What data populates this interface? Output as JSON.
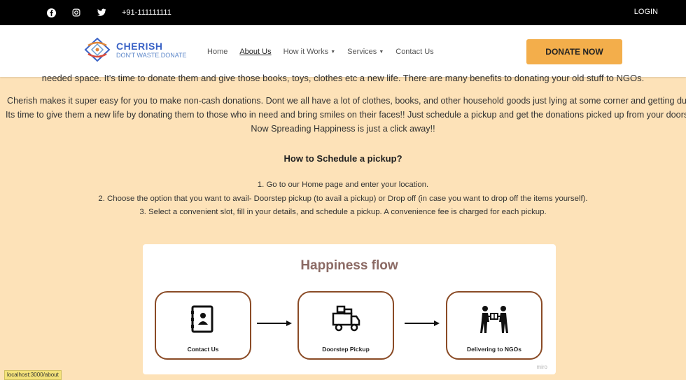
{
  "topbar": {
    "phone": "+91-111111111",
    "login": "LOGIN",
    "icons": [
      "facebook-icon",
      "instagram-icon",
      "twitter-icon"
    ]
  },
  "brand": {
    "title": "CHERISH",
    "tagline": "DON'T WASTE.DONATE"
  },
  "nav": {
    "home": "Home",
    "about": "About Us",
    "how_it_works": "How it Works",
    "services": "Services",
    "contact": "Contact Us"
  },
  "donate_button": "DONATE NOW",
  "content": {
    "clipped_line": "needed space. It's time to donate them and give those books, toys, clothes etc a new life. There are many benefits to donating your old stuff to NGOs.",
    "para_line1": "Cherish makes it super easy for you to make non-cash donations. Dont we all have a lot of clothes, books, and other household goods just lying at some corner and getting dusted",
    "para_line2": "Its time to give them a new life by donating them to those who in need and bring smiles on their faces!! Just schedule a pickup and get the donations picked up from your doorstep",
    "para_line3": "Now Spreading Happiness is just a click away!!",
    "howto_title": "How to Schedule a pickup?",
    "steps": [
      "1. Go to our Home page and enter your location.",
      "2. Choose the option that you want to avail- Doorstep pickup (to avail a pickup) or Drop off (in case you want to drop off the items yourself).",
      "3. Select a convenient slot, fill in your details, and schedule a pickup. A convenience fee is charged for each pickup."
    ]
  },
  "flow": {
    "title": "Happiness flow",
    "steps": [
      "Contact  Us",
      "Doorstep Pickup",
      "Delivering to NGOs"
    ],
    "watermark": "miro"
  },
  "status_url": "localhost:3000/about",
  "colors": {
    "page_bg": "#fde2b8",
    "accent": "#f3ae4b",
    "flow_border": "#8a4b26",
    "brand_blue": "#3b63c6"
  }
}
